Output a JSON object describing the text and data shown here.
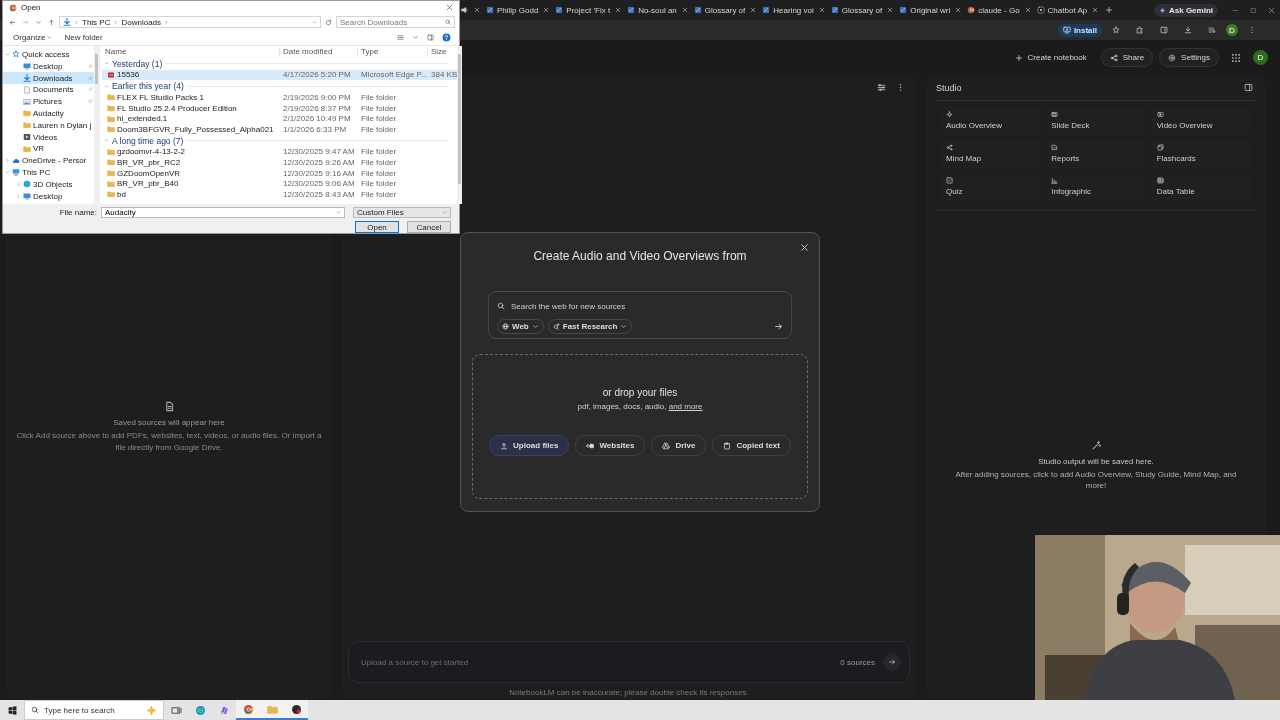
{
  "browser": {
    "tabs": [
      {
        "kind": "speaker"
      },
      {
        "kind": "tabdoc",
        "title": "Philip Godd"
      },
      {
        "kind": "tabdoc",
        "title": "Project 'Fix t"
      },
      {
        "kind": "tabdoc",
        "title": "No-soul an"
      },
      {
        "kind": "tabdoc",
        "title": "Glossary of"
      },
      {
        "kind": "tabdoc",
        "title": "Hearing voi"
      },
      {
        "kind": "tabdoc",
        "title": "Glossary of"
      },
      {
        "kind": "tabdoc",
        "title": "Original wri"
      },
      {
        "kind": "google",
        "title": "claude - Go"
      },
      {
        "kind": "chatbot",
        "title": "Chatbot Ap"
      }
    ],
    "ask_gemini": "Ask Gemini",
    "install": "Install",
    "profile": "D"
  },
  "app_header": {
    "create": "Create notebook",
    "share": "Share",
    "settings": "Settings",
    "avatar": "D"
  },
  "sources_panel": {
    "empty_title": "Saved sources will appear here",
    "empty_text": "Click Add source above to add PDFs, websites, text, videos, or audio files. Or import a file directly from Google Drive."
  },
  "chat": {
    "placeholder": "Upload a source to get started",
    "source_count": "0 sources",
    "disclaimer": "NotebookLM can be inaccurate; please double check its responses."
  },
  "studio": {
    "title": "Studio",
    "tiles": [
      {
        "label": "Audio Overview",
        "kind": "sparkle"
      },
      {
        "label": "Slide Deck",
        "kind": "slides"
      },
      {
        "label": "Video Overview",
        "kind": "video"
      },
      {
        "label": "Mind Map",
        "kind": "mindmap"
      },
      {
        "label": "Reports",
        "kind": "reports"
      },
      {
        "label": "Flashcards",
        "kind": "flashcards"
      },
      {
        "label": "Quiz",
        "kind": "quiz"
      },
      {
        "label": "Infographic",
        "kind": "infographic"
      },
      {
        "label": "Data Table",
        "kind": "table"
      }
    ],
    "empty_title": "Studio output will be saved here.",
    "empty_text": "After adding sources, click to add Audio Overview, Study Guide, Mind Map, and more!"
  },
  "modal": {
    "title": "Create Audio and Video Overviews from",
    "search_placeholder": "Search the web for new sources",
    "chips": [
      {
        "label": "Web",
        "kind": "globe"
      },
      {
        "label": "Fast Research",
        "kind": "research"
      }
    ],
    "drop_title": "or drop your files",
    "drop_text": "pdf, images, docs, audio,",
    "drop_link": "and more",
    "buttons": [
      {
        "label": "Upload files",
        "kind": "upload",
        "highlighted": true
      },
      {
        "label": "Websites",
        "kind": "link",
        "highlighted": false
      },
      {
        "label": "Drive",
        "kind": "drive",
        "highlighted": false
      },
      {
        "label": "Copied text",
        "kind": "clipboard",
        "highlighted": false
      }
    ]
  },
  "file_dialog": {
    "title": "Open",
    "path": [
      "This PC",
      "Downloads"
    ],
    "search_placeholder": "Search Downloads",
    "organize": "Organize",
    "new_folder": "New folder",
    "nav": [
      {
        "label": "Quick access",
        "kind": "star",
        "expanded": true,
        "selected": false,
        "children": [
          {
            "label": "Desktop",
            "kind": "desktop",
            "pinned": true,
            "selected": false
          },
          {
            "label": "Downloads",
            "kind": "download",
            "pinned": true,
            "selected": true
          },
          {
            "label": "Documents",
            "kind": "docs",
            "pinned": true,
            "selected": false
          },
          {
            "label": "Pictures",
            "kind": "pictures",
            "pinned": true,
            "selected": false
          },
          {
            "label": "Audacity",
            "kind": "folder",
            "pinned": false,
            "selected": false
          },
          {
            "label": "Lauren n Dylan j",
            "kind": "folder",
            "pinned": false,
            "selected": false
          },
          {
            "label": "Videos",
            "kind": "videos",
            "pinned": false,
            "selected": false
          },
          {
            "label": "VR",
            "kind": "folder",
            "pinned": false,
            "selected": false
          }
        ]
      },
      {
        "label": "OneDrive - Persor",
        "kind": "cloud",
        "expanded": false,
        "selected": false
      },
      {
        "label": "This PC",
        "kind": "pc",
        "expanded": true,
        "selected": false,
        "children": [
          {
            "label": "3D Objects",
            "kind": "cube",
            "expanded": false,
            "selected": false
          },
          {
            "label": "Desktop",
            "kind": "desktop",
            "expanded": false,
            "selected": false
          }
        ]
      }
    ],
    "columns": [
      "Name",
      "Date modified",
      "Type",
      "Size"
    ],
    "groups": [
      {
        "label": "Yesterday (1)",
        "expanded": true,
        "files": [
          {
            "name": "15536",
            "date": "4/17/2026 5:20 PM",
            "type": "Microsoft Edge P...",
            "size": "384 KB",
            "kind": "pdf",
            "selected": true
          }
        ]
      },
      {
        "label": "Earlier this year (4)",
        "expanded": true,
        "files": [
          {
            "name": "FLEX FL Studio Packs 1",
            "date": "2/19/2026 9:00 PM",
            "type": "File folder",
            "kind": "folder",
            "selected": false
          },
          {
            "name": "FL Studio 25.2.4 Producer Edition",
            "date": "2/19/2026 8:37 PM",
            "type": "File folder",
            "kind": "folder",
            "selected": false
          },
          {
            "name": "hl_extended.1",
            "date": "2/1/2026 10:49 PM",
            "type": "File folder",
            "kind": "folder",
            "selected": false
          },
          {
            "name": "Doom3BFGVR_Fully_Possessed_Alpha021",
            "date": "1/1/2026 6:33 PM",
            "type": "File folder",
            "kind": "folder",
            "selected": false
          }
        ]
      },
      {
        "label": "A long time ago (7)",
        "expanded": true,
        "files": [
          {
            "name": "gzdoomvr-4-13-2-2",
            "date": "12/30/2025 9:47 AM",
            "type": "File folder",
            "kind": "folder",
            "selected": false
          },
          {
            "name": "BR_VR_pbr_RC2",
            "date": "12/30/2025 9:26 AM",
            "type": "File folder",
            "kind": "folder",
            "selected": false
          },
          {
            "name": "GZDoomOpenVR",
            "date": "12/30/2025 9:16 AM",
            "type": "File folder",
            "kind": "folder",
            "selected": false
          },
          {
            "name": "BR_VR_pbr_B40",
            "date": "12/30/2025 9:06 AM",
            "type": "File folder",
            "kind": "folder",
            "selected": false
          },
          {
            "name": "bd",
            "date": "12/30/2025 8:43 AM",
            "type": "File folder",
            "kind": "folder",
            "selected": false
          }
        ]
      }
    ],
    "file_name_label": "File name:",
    "file_name": "Audacity",
    "filter": "Custom Files",
    "open": "Open",
    "cancel": "Cancel"
  },
  "taskbar": {
    "search_placeholder": "Type here to search",
    "apps": [
      {
        "kind": "taskview",
        "running": false
      },
      {
        "kind": "edge",
        "running": false
      },
      {
        "kind": "copilot",
        "running": false
      },
      {
        "kind": "chrome",
        "running": true
      },
      {
        "kind": "explorer",
        "running": true
      },
      {
        "kind": "obs",
        "running": true
      }
    ]
  }
}
